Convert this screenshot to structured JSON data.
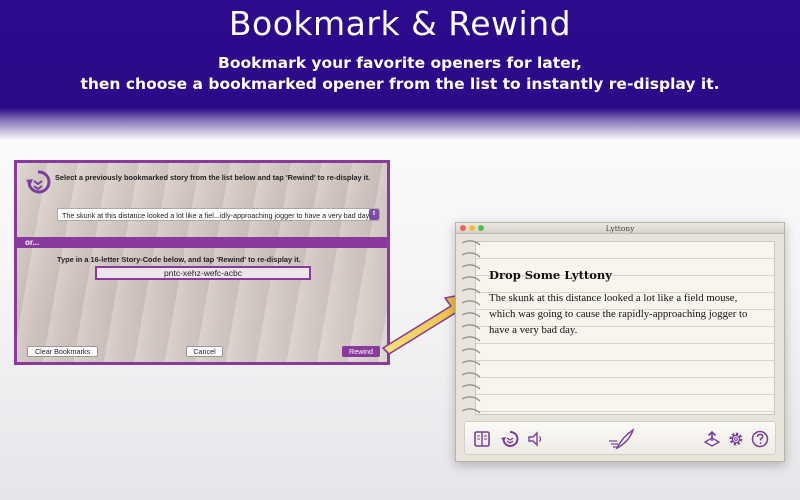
{
  "banner": {
    "title": "Bookmark & Rewind",
    "subtitle_line1": "Bookmark your favorite openers for later,",
    "subtitle_line2": "then choose a bookmarked opener from the list to instantly re-display it."
  },
  "dialog": {
    "instruction_select": "Select a previously bookmarked story from the list below and tap 'Rewind' to re-display it.",
    "selected_story": "The skunk at this distance looked a lot like a fiel...idly-approaching jogger to have a very bad day.",
    "or_label": "or...",
    "instruction_code": "Type in a 16-letter Story-Code below, and tap 'Rewind' to re-display it.",
    "story_code": "pntc-xehz-wefc-acbc",
    "clear_button": "Clear Bookmarks",
    "cancel_button": "Cancel",
    "rewind_button": "Rewind"
  },
  "window": {
    "title": "Lyttony",
    "poem_title": "Drop Some Lyttony",
    "poem_body": "The skunk at this distance looked a lot like a field mouse, which was going to cause the rapidly-approaching jogger to have a very bad day."
  },
  "colors": {
    "banner": "#2b0a88",
    "accent": "#8a3a9c",
    "toolbar_icon": "#7b3e9c"
  },
  "toolbar_icons": [
    "bookmark-icon",
    "rewind-icon",
    "speaker-icon",
    "quill-icon",
    "share-icon",
    "gear-icon",
    "help-icon"
  ]
}
